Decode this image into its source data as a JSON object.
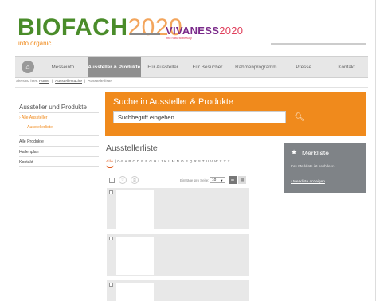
{
  "header": {
    "logo_main": "BIOFACH",
    "logo_year": "2020",
    "logo_tagline": "into organic",
    "partner_main": "VIVANESS",
    "partner_year": "2020",
    "partner_tagline": "into natural beauty"
  },
  "nav": {
    "home_icon": "home-icon",
    "items": [
      {
        "label": "Messeinfo",
        "active": false
      },
      {
        "label": "Aussteller & Produkte",
        "active": true
      },
      {
        "label": "Für Aussteller",
        "active": false
      },
      {
        "label": "Für Besucher",
        "active": false
      },
      {
        "label": "Rahmenprogramm",
        "active": false
      },
      {
        "label": "Presse",
        "active": false
      },
      {
        "label": "Kontakt",
        "active": false
      }
    ]
  },
  "breadcrumb": {
    "prefix": "Sie sind hier:",
    "items": [
      "Home",
      "Ausstellersuche",
      "Ausstellerliste"
    ]
  },
  "sidebar": {
    "title": "Aussteller und Produkte",
    "sub_item": "Alle Aussteller",
    "sub_sub_item": "Ausstellerliste",
    "items": [
      "Alle Produkte",
      "Hallenplan",
      "Kontakt"
    ]
  },
  "search": {
    "title": "Suche in Aussteller & Produkte",
    "value": "Suchbegriff eingeben",
    "button_icon": "search-icon"
  },
  "list": {
    "title": "Ausstellerliste",
    "alpha_all": "Alle",
    "alpha_letters": "0-9 A B C D E F G H I J K L M N O P Q R S T U V W X Y Z",
    "per_page_label": "Einträge pro Seite:",
    "per_page_value": "10",
    "toolbar_icons": [
      "merkliste-icon",
      "print-icon"
    ],
    "view_icons": [
      "list-view-icon",
      "grid-view-icon"
    ]
  },
  "merkliste": {
    "title": "Merkliste",
    "icon": "star-icon",
    "text": "Ihre Merkliste ist noch leer.",
    "link": "Merkliste anzeigen"
  },
  "colors": {
    "brand_green": "#4a8c2a",
    "accent_orange": "#f08a1c",
    "vivaness_purple": "#7a2a8a",
    "nav_active": "#8f8f8f"
  }
}
